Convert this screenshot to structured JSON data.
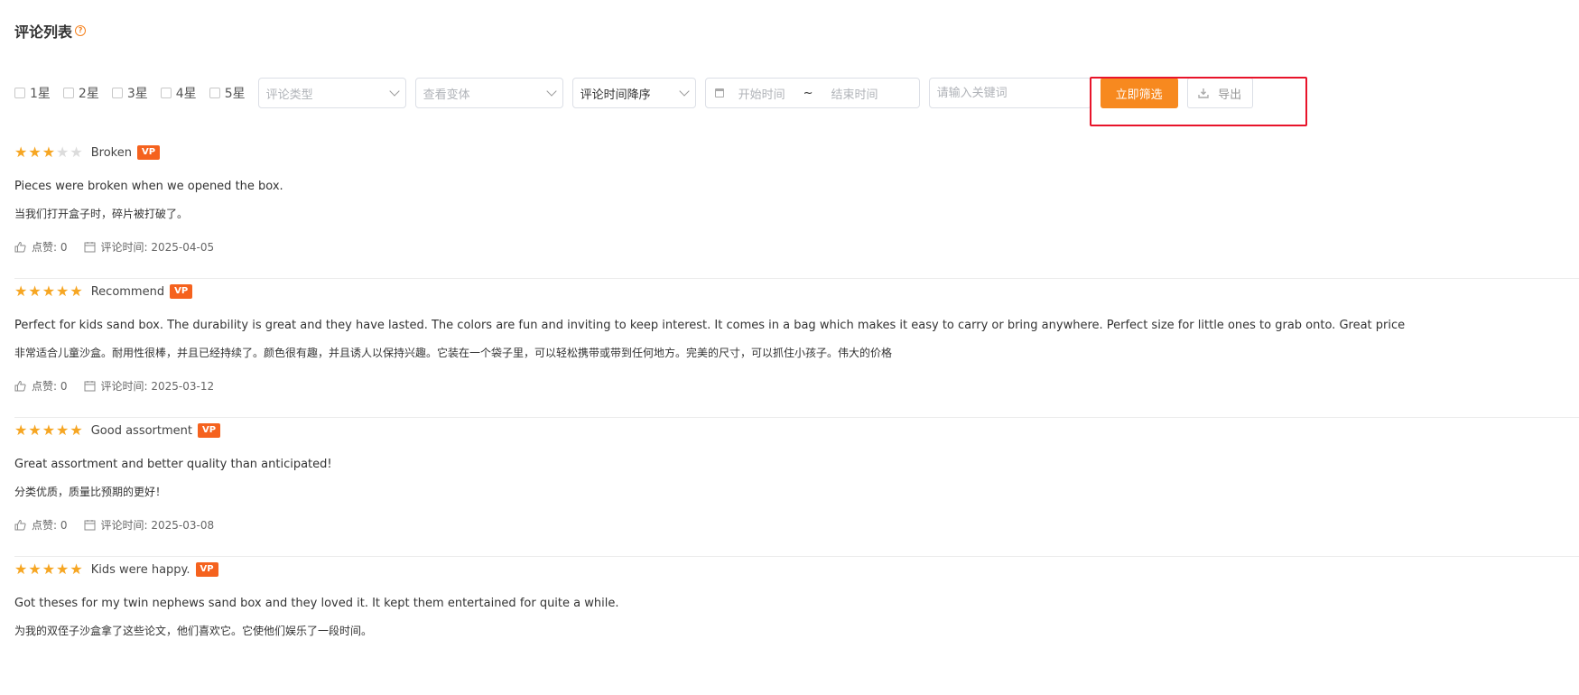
{
  "header": {
    "title": "评论列表",
    "help_glyph": "?"
  },
  "filters": {
    "star_options": [
      "1星",
      "2星",
      "3星",
      "4星",
      "5星"
    ],
    "review_type_placeholder": "评论类型",
    "variant_placeholder": "查看变体",
    "sort_value": "评论时间降序",
    "date_start_placeholder": "开始时间",
    "date_separator": "~",
    "date_end_placeholder": "结束时间",
    "keyword_placeholder": "请输入关键词",
    "filter_button_label": "立即筛选",
    "export_button_label": "导出"
  },
  "colors": {
    "accent": "#f7891f",
    "star": "#f6a623",
    "badge": "#f5621e",
    "highlight": "#e8142a"
  },
  "reviews": [
    {
      "rating": 3,
      "title": "Broken",
      "badge": "VP",
      "text_en": "Pieces were broken when we opened the box.",
      "text_zh": "当我们打开盒子时，碎片被打破了。",
      "likes": "点赞: 0",
      "date": "评论时间: 2025-04-05"
    },
    {
      "rating": 5,
      "title": "Recommend",
      "badge": "VP",
      "text_en": "Perfect for kids sand box. The durability is great and they have lasted. The colors are fun and inviting to keep interest. It comes in a bag which makes it easy to carry or bring anywhere. Perfect size for little ones to grab onto. Great price",
      "text_zh": "非常适合儿童沙盒。耐用性很棒，并且已经持续了。颜色很有趣，并且诱人以保持兴趣。它装在一个袋子里，可以轻松携带或带到任何地方。完美的尺寸，可以抓住小孩子。伟大的价格",
      "likes": "点赞: 0",
      "date": "评论时间: 2025-03-12"
    },
    {
      "rating": 5,
      "title": "Good assortment",
      "badge": "VP",
      "text_en": "Great assortment and better quality than anticipated!",
      "text_zh": "分类优质，质量比预期的更好！",
      "likes": "点赞: 0",
      "date": "评论时间: 2025-03-08"
    },
    {
      "rating": 5,
      "title": "Kids were happy.",
      "badge": "VP",
      "text_en": "Got theses for my twin nephews sand box and they loved it. It kept them entertained for quite a while.",
      "text_zh": "为我的双侄子沙盒拿了这些论文，他们喜欢它。它使他们娱乐了一段时间。",
      "likes": "",
      "date": ""
    }
  ]
}
